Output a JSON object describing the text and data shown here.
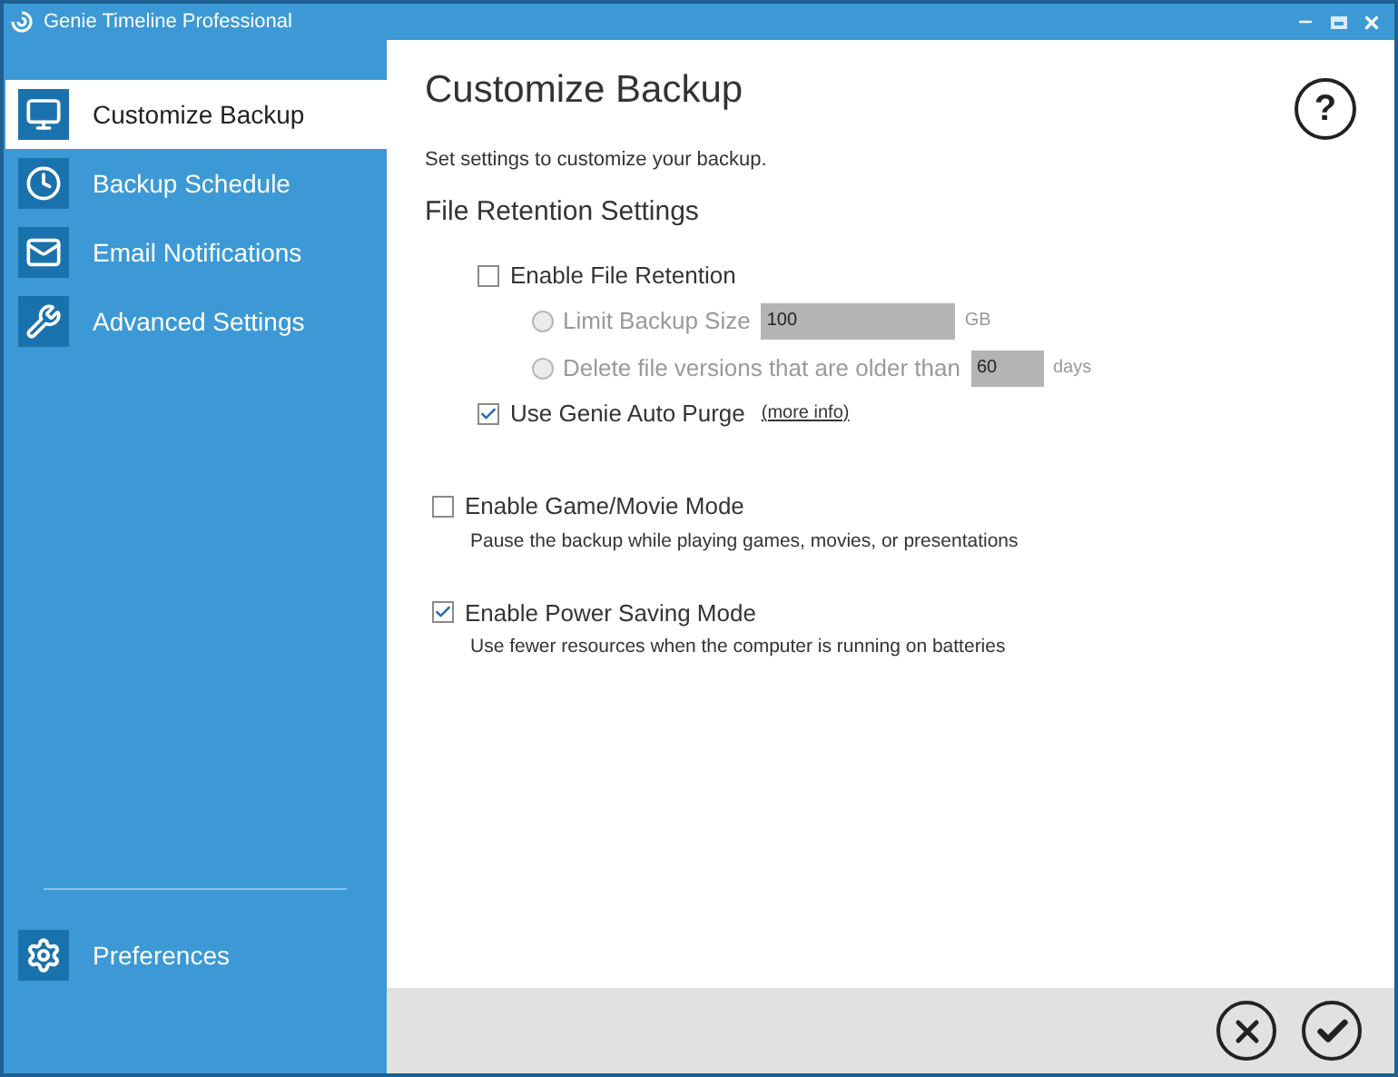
{
  "window": {
    "title": "Genie Timeline Professional"
  },
  "sidebar": {
    "items": [
      {
        "label": "Customize Backup",
        "selected": true
      },
      {
        "label": "Backup Schedule",
        "selected": false
      },
      {
        "label": "Email Notifications",
        "selected": false
      },
      {
        "label": "Advanced Settings",
        "selected": false
      }
    ],
    "footer_item": {
      "label": "Preferences"
    }
  },
  "page": {
    "title": "Customize Backup",
    "help": "?",
    "subtitle": "Set settings to customize your backup.",
    "section": "File Retention Settings",
    "retention": {
      "label": "Enable File Retention",
      "checked": false
    },
    "retention_options": [
      {
        "label": "Limit Backup Size",
        "selected": false,
        "disabled": true,
        "value": "100",
        "unit": "GB",
        "wide": true
      },
      {
        "label": "Delete file versions that are older than",
        "selected": false,
        "disabled": true,
        "value": "60",
        "unit": "days",
        "wide": false
      }
    ],
    "auto_purge": {
      "label": "Use Genie Auto Purge",
      "checked": true,
      "link": "(more info)"
    },
    "modes": [
      {
        "label": "Enable Game/Movie Mode",
        "checked": false,
        "description": "Pause the backup while playing games, movies, or presentations"
      },
      {
        "label": "Enable Power Saving Mode",
        "checked": true,
        "description": "Use fewer resources when the computer is running on batteries"
      }
    ]
  }
}
